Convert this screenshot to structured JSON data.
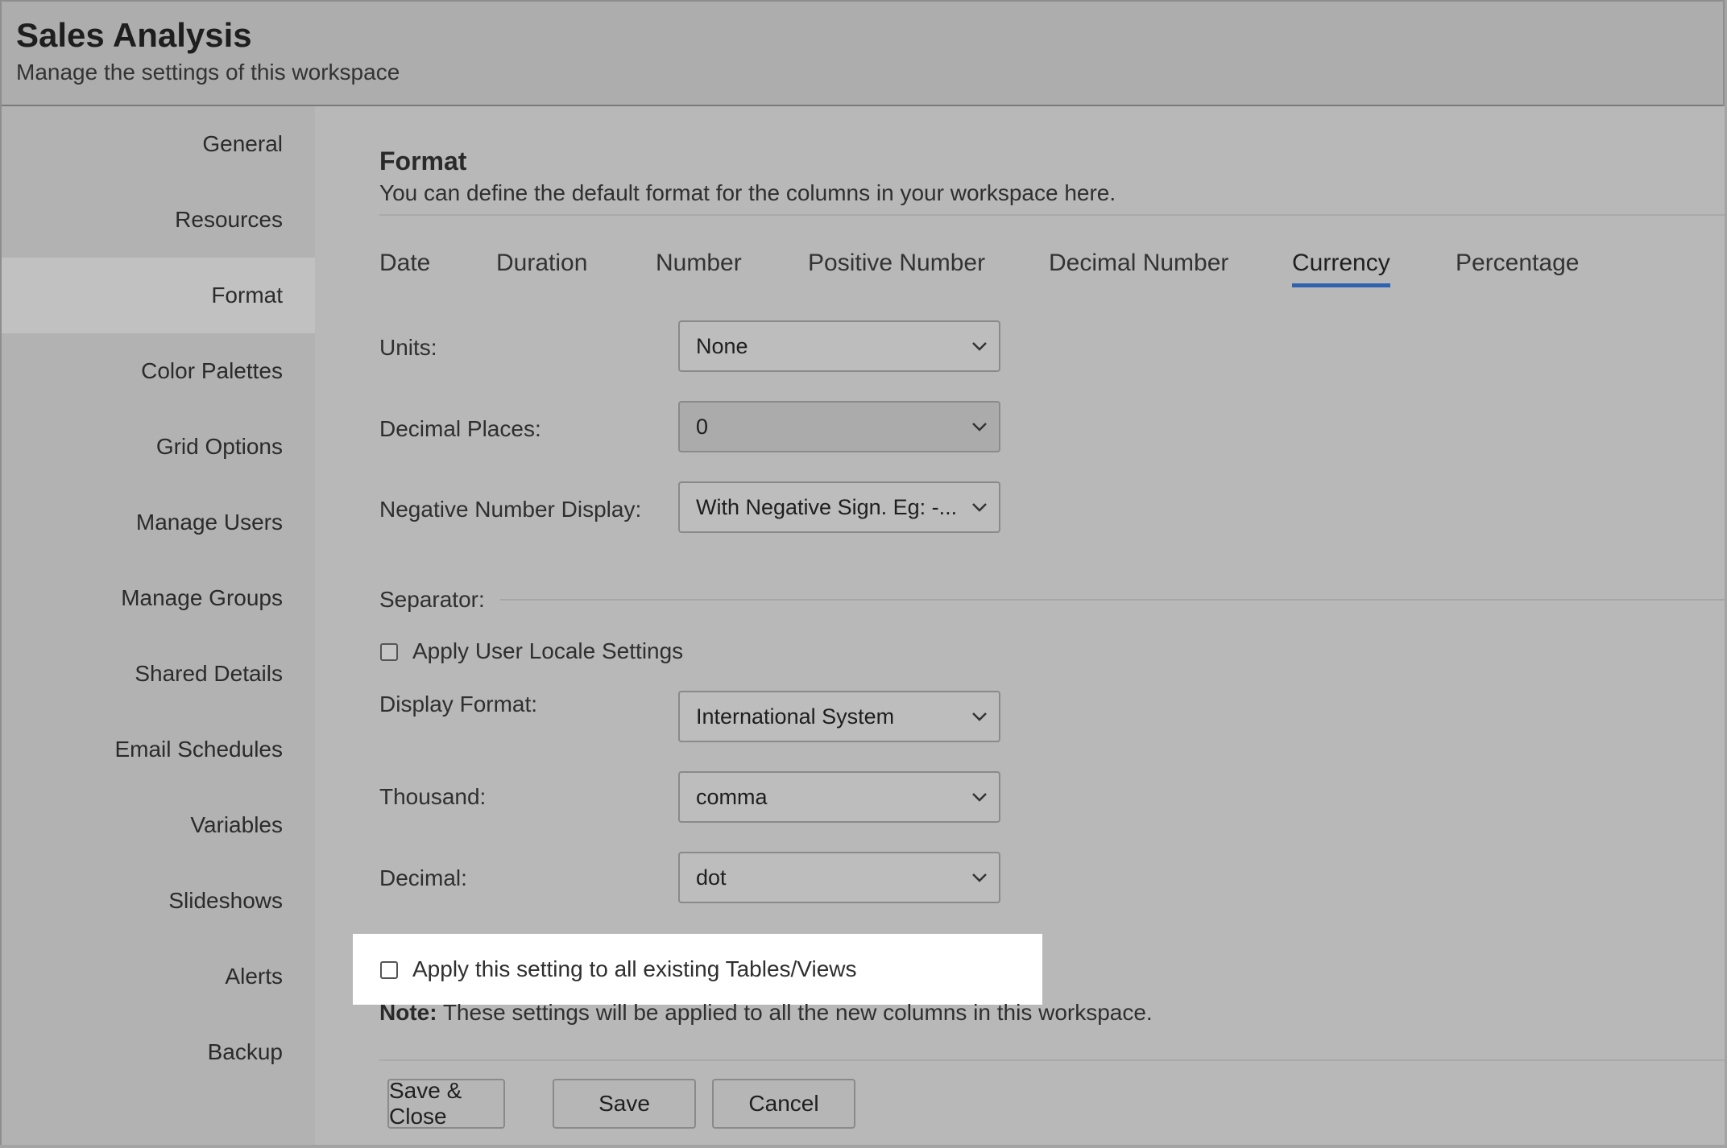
{
  "header": {
    "title": "Sales Analysis",
    "subtitle": "Manage the settings of this workspace"
  },
  "sidebar": {
    "items": [
      {
        "label": "General"
      },
      {
        "label": "Resources"
      },
      {
        "label": "Format",
        "active": true
      },
      {
        "label": "Color Palettes"
      },
      {
        "label": "Grid Options"
      },
      {
        "label": "Manage Users"
      },
      {
        "label": "Manage Groups"
      },
      {
        "label": "Shared Details"
      },
      {
        "label": "Email Schedules"
      },
      {
        "label": "Variables"
      },
      {
        "label": "Slideshows"
      },
      {
        "label": "Alerts"
      },
      {
        "label": "Backup"
      }
    ]
  },
  "main": {
    "title": "Format",
    "description": "You can define the default format for the columns in your workspace here.",
    "tabs": [
      {
        "label": "Date"
      },
      {
        "label": "Duration"
      },
      {
        "label": "Number"
      },
      {
        "label": "Positive Number"
      },
      {
        "label": "Decimal Number"
      },
      {
        "label": "Currency",
        "active": true
      },
      {
        "label": "Percentage"
      }
    ],
    "fields": {
      "units": {
        "label": "Units:",
        "value": "None"
      },
      "decimal_places": {
        "label": "Decimal Places:",
        "value": "0"
      },
      "negative_display": {
        "label": "Negative Number Display:",
        "value": "With Negative Sign. Eg: -..."
      },
      "separator_label": "Separator:",
      "apply_locale": {
        "label": "Apply User Locale Settings",
        "checked": false
      },
      "display_format": {
        "label": "Display Format:",
        "value": "International System"
      },
      "thousand": {
        "label": "Thousand:",
        "value": "comma"
      },
      "decimal": {
        "label": "Decimal:",
        "value": "dot"
      }
    },
    "apply_all": {
      "label": "Apply this setting to all existing Tables/Views",
      "checked": false
    },
    "note": {
      "bold": "Note:",
      "text": " These settings will be applied to all the new columns in this workspace."
    },
    "buttons": {
      "save_close": "Save & Close",
      "save": "Save",
      "cancel": "Cancel"
    }
  },
  "colors": {
    "accent": "#2d62b0",
    "highlight": "#ffffff"
  }
}
